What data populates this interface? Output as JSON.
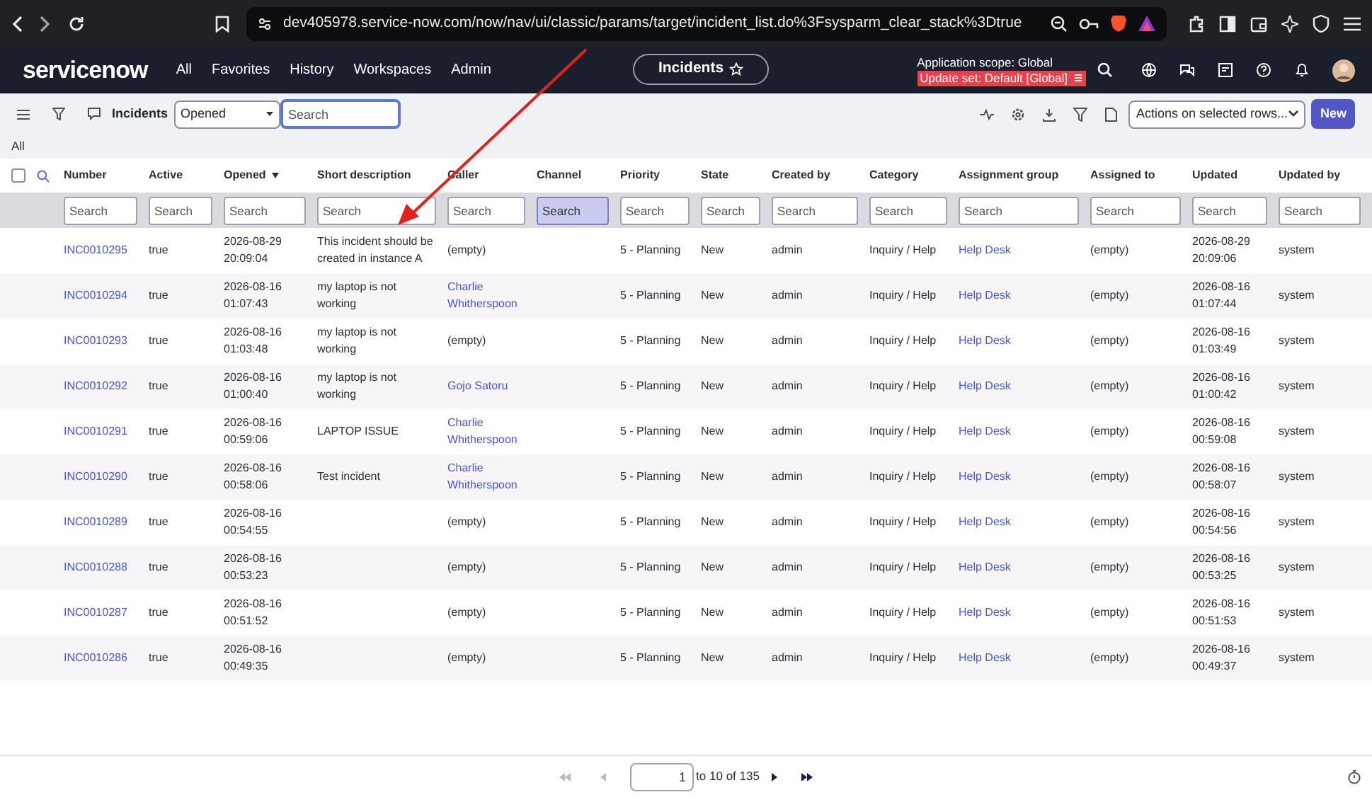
{
  "browser": {
    "url": "dev405978.service-now.com/now/nav/ui/classic/params/target/incident_list.do%3Fsysparm_clear_stack%3Dtrue"
  },
  "nav": {
    "logo": "servicenow",
    "menu": [
      "All",
      "Favorites",
      "History",
      "Workspaces",
      "Admin"
    ],
    "context_pill": "Incidents",
    "scope": "Application scope: Global",
    "update_set": "Update set: Default [Global]"
  },
  "toolbar": {
    "title": "Incidents",
    "filter_select": "Opened",
    "search": {
      "placeholder": "Search"
    },
    "actions_select": "Actions on selected rows...",
    "new_button": "New"
  },
  "breadcrumb": "All",
  "select_all": {
    "checked": false
  },
  "columns": [
    {
      "label": "Number",
      "placeholder": "Search",
      "focused": false,
      "sorted": false
    },
    {
      "label": "Active",
      "placeholder": "Search",
      "focused": false,
      "sorted": false
    },
    {
      "label": "Opened",
      "placeholder": "Search",
      "focused": false,
      "sorted": true
    },
    {
      "label": "Short description",
      "placeholder": "Search",
      "focused": false,
      "sorted": false
    },
    {
      "label": "Caller",
      "placeholder": "Search",
      "focused": false,
      "sorted": false
    },
    {
      "label": "Channel",
      "placeholder": "Search",
      "focused": true,
      "sorted": false
    },
    {
      "label": "Priority",
      "placeholder": "Search",
      "focused": false,
      "sorted": false
    },
    {
      "label": "State",
      "placeholder": "Search",
      "focused": false,
      "sorted": false
    },
    {
      "label": "Created by",
      "placeholder": "Search",
      "focused": false,
      "sorted": false
    },
    {
      "label": "Category",
      "placeholder": "Search",
      "focused": false,
      "sorted": false
    },
    {
      "label": "Assignment group",
      "placeholder": "Search",
      "focused": false,
      "sorted": false
    },
    {
      "label": "Assigned to",
      "placeholder": "Search",
      "focused": false,
      "sorted": false
    },
    {
      "label": "Updated",
      "placeholder": "Search",
      "focused": false,
      "sorted": false
    },
    {
      "label": "Updated by",
      "placeholder": "Search",
      "focused": false,
      "sorted": false
    }
  ],
  "rows": [
    {
      "number": "INC0010295",
      "active": "true",
      "opened": "2026-08-29 20:09:04",
      "short_description": "This incident should be created in instance A",
      "caller": {
        "text": "(empty)",
        "link": false
      },
      "priority": "5 - Planning",
      "state": "New",
      "created_by": "admin",
      "category": "Inquiry / Help",
      "assignment_group": "Help Desk",
      "assigned_to": "(empty)",
      "updated": "2026-08-29 20:09:06",
      "updated_by": "system"
    },
    {
      "number": "INC0010294",
      "active": "true",
      "opened": "2026-08-16 01:07:43",
      "short_description": "my laptop is not working",
      "caller": {
        "text": "Charlie Whitherspoon",
        "link": true
      },
      "priority": "5 - Planning",
      "state": "New",
      "created_by": "admin",
      "category": "Inquiry / Help",
      "assignment_group": "Help Desk",
      "assigned_to": "(empty)",
      "updated": "2026-08-16 01:07:44",
      "updated_by": "system"
    },
    {
      "number": "INC0010293",
      "active": "true",
      "opened": "2026-08-16 01:03:48",
      "short_description": "my laptop is not working",
      "caller": {
        "text": "(empty)",
        "link": false
      },
      "priority": "5 - Planning",
      "state": "New",
      "created_by": "admin",
      "category": "Inquiry / Help",
      "assignment_group": "Help Desk",
      "assigned_to": "(empty)",
      "updated": "2026-08-16 01:03:49",
      "updated_by": "system"
    },
    {
      "number": "INC0010292",
      "active": "true",
      "opened": "2026-08-16 01:00:40",
      "short_description": "my laptop is not working",
      "caller": {
        "text": "Gojo Satoru",
        "link": true
      },
      "priority": "5 - Planning",
      "state": "New",
      "created_by": "admin",
      "category": "Inquiry / Help",
      "assignment_group": "Help Desk",
      "assigned_to": "(empty)",
      "updated": "2026-08-16 01:00:42",
      "updated_by": "system"
    },
    {
      "number": "INC0010291",
      "active": "true",
      "opened": "2026-08-16 00:59:06",
      "short_description": "LAPTOP ISSUE",
      "caller": {
        "text": "Charlie Whitherspoon",
        "link": true
      },
      "priority": "5 - Planning",
      "state": "New",
      "created_by": "admin",
      "category": "Inquiry / Help",
      "assignment_group": "Help Desk",
      "assigned_to": "(empty)",
      "updated": "2026-08-16 00:59:08",
      "updated_by": "system"
    },
    {
      "number": "INC0010290",
      "active": "true",
      "opened": "2026-08-16 00:58:06",
      "short_description": "Test incident",
      "caller": {
        "text": "Charlie Whitherspoon",
        "link": true
      },
      "priority": "5 - Planning",
      "state": "New",
      "created_by": "admin",
      "category": "Inquiry / Help",
      "assignment_group": "Help Desk",
      "assigned_to": "(empty)",
      "updated": "2026-08-16 00:58:07",
      "updated_by": "system"
    },
    {
      "number": "INC0010289",
      "active": "true",
      "opened": "2026-08-16 00:54:55",
      "caller": {
        "text": "(empty)",
        "link": false
      },
      "priority": "5 - Planning",
      "state": "New",
      "created_by": "admin",
      "category": "Inquiry / Help",
      "assignment_group": "Help Desk",
      "assigned_to": "(empty)",
      "updated": "2026-08-16 00:54:56",
      "updated_by": "system"
    },
    {
      "number": "INC0010288",
      "active": "true",
      "opened": "2026-08-16 00:53:23",
      "caller": {
        "text": "(empty)",
        "link": false
      },
      "priority": "5 - Planning",
      "state": "New",
      "created_by": "admin",
      "category": "Inquiry / Help",
      "assignment_group": "Help Desk",
      "assigned_to": "(empty)",
      "updated": "2026-08-16 00:53:25",
      "updated_by": "system"
    },
    {
      "number": "INC0010287",
      "active": "true",
      "opened": "2026-08-16 00:51:52",
      "caller": {
        "text": "(empty)",
        "link": false
      },
      "priority": "5 - Planning",
      "state": "New",
      "created_by": "admin",
      "category": "Inquiry / Help",
      "assignment_group": "Help Desk",
      "assigned_to": "(empty)",
      "updated": "2026-08-16 00:51:53",
      "updated_by": "system"
    },
    {
      "number": "INC0010286",
      "active": "true",
      "opened": "2026-08-16 00:49:35",
      "caller": {
        "text": "(empty)",
        "link": false
      },
      "priority": "5 - Planning",
      "state": "New",
      "created_by": "admin",
      "category": "Inquiry / Help",
      "assignment_group": "Help Desk",
      "assigned_to": "(empty)",
      "updated": "2026-08-16 00:49:37",
      "updated_by": "system"
    }
  ],
  "pagination": {
    "page": "1",
    "range": "to 10 of 135"
  }
}
